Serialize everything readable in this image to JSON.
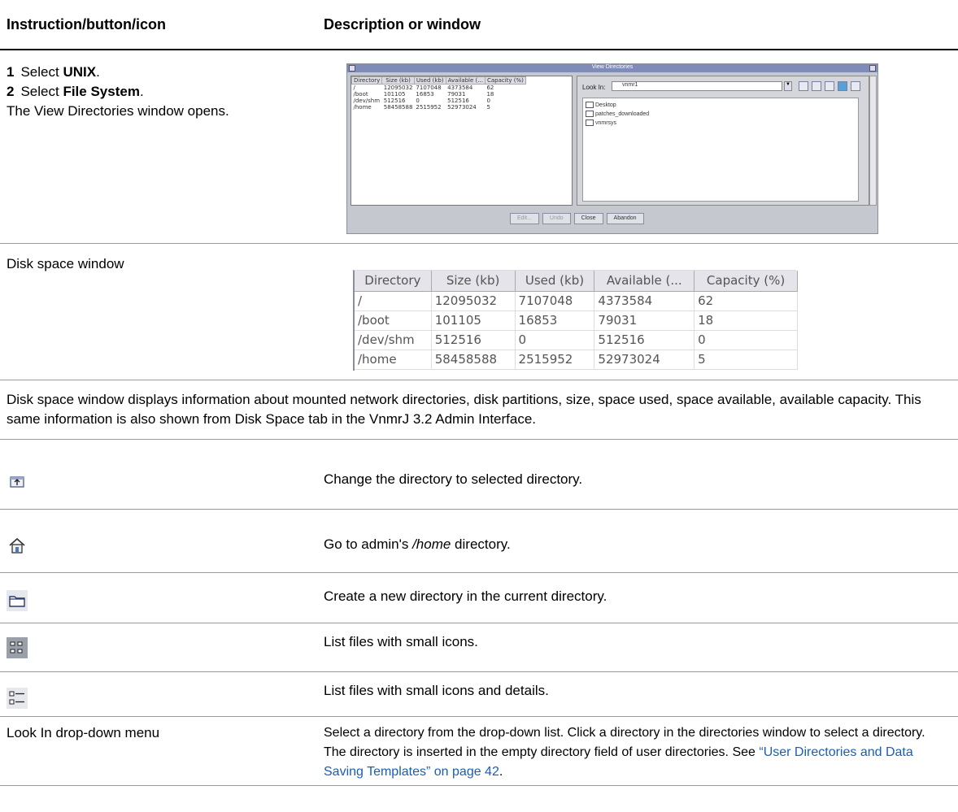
{
  "header": {
    "col1": "Instruction/button/icon",
    "col2": "Description or window"
  },
  "steps": {
    "step1_num": "1",
    "step1_pre": "Select ",
    "step1_bold": "UNIX",
    "step1_post": ".",
    "step2_num": "2",
    "step2_pre": "Select ",
    "step2_bold": "File System",
    "step2_post": ".",
    "note": "The View Directories window opens."
  },
  "view_directories": {
    "title": "View Directories",
    "columns": [
      "Directory",
      "Size (kb)",
      "Used (kb)",
      "Available (...",
      "Capacity (%)"
    ],
    "rows": [
      [
        "/",
        "12095032",
        "7107048",
        "4373584",
        "62"
      ],
      [
        "/boot",
        "101105",
        "16853",
        "79031",
        "18"
      ],
      [
        "/dev/shm",
        "512516",
        "0",
        "512516",
        "0"
      ],
      [
        "/home",
        "58458588",
        "2515952",
        "52973024",
        "5"
      ]
    ],
    "look_in_label": "Look In:",
    "look_in_value": "vnmr1",
    "files": [
      "Desktop",
      "patches_downloaded",
      "vnmrsys"
    ],
    "buttons": [
      "Edit...",
      "Undo",
      "Close",
      "Abandon"
    ]
  },
  "disk_space_label": "Disk space window",
  "disk_space": {
    "columns": [
      "Directory",
      "Size (kb)",
      "Used (kb)",
      "Available (...",
      "Capacity (%)"
    ],
    "rows": [
      [
        "/",
        "12095032",
        "7107048",
        "4373584",
        "62"
      ],
      [
        "/boot",
        "101105",
        "16853",
        "79031",
        "18"
      ],
      [
        "/dev/shm",
        "512516",
        "0",
        "512516",
        "0"
      ],
      [
        "/home",
        "58458588",
        "2515952",
        "52973024",
        "5"
      ]
    ]
  },
  "paragraph": "Disk space window displays information about mounted network directories, disk partitions, size, space used, space available, available capacity. This same information is also shown from Disk Space tab in the VnmrJ 3.2 Admin Interface.",
  "icons": [
    {
      "icon": "change-directory-icon",
      "text": "Change the directory to selected directory."
    },
    {
      "icon": "home-icon",
      "text_pre": "Go to admin's ",
      "text_em": "/home",
      "text_post": " directory."
    },
    {
      "icon": "new-folder-icon",
      "text": "Create a new directory in the current directory."
    },
    {
      "icon": "list-icon",
      "text": "List files with small icons."
    },
    {
      "icon": "details-icon",
      "text": "List files with small icons and details."
    }
  ],
  "look_in": {
    "label": "Look In drop-down menu",
    "desc1": "Select a directory from the drop-down list. Click a directory in the directories window to select a directory. The directory is inserted in the empty directory field of user directories.",
    "see": "See ",
    "link": "“User Directories and Data Saving Templates” on page 42",
    "end": "."
  },
  "colors": {
    "link": "#1a5eb4",
    "title_bar": "#7f8cb8"
  }
}
